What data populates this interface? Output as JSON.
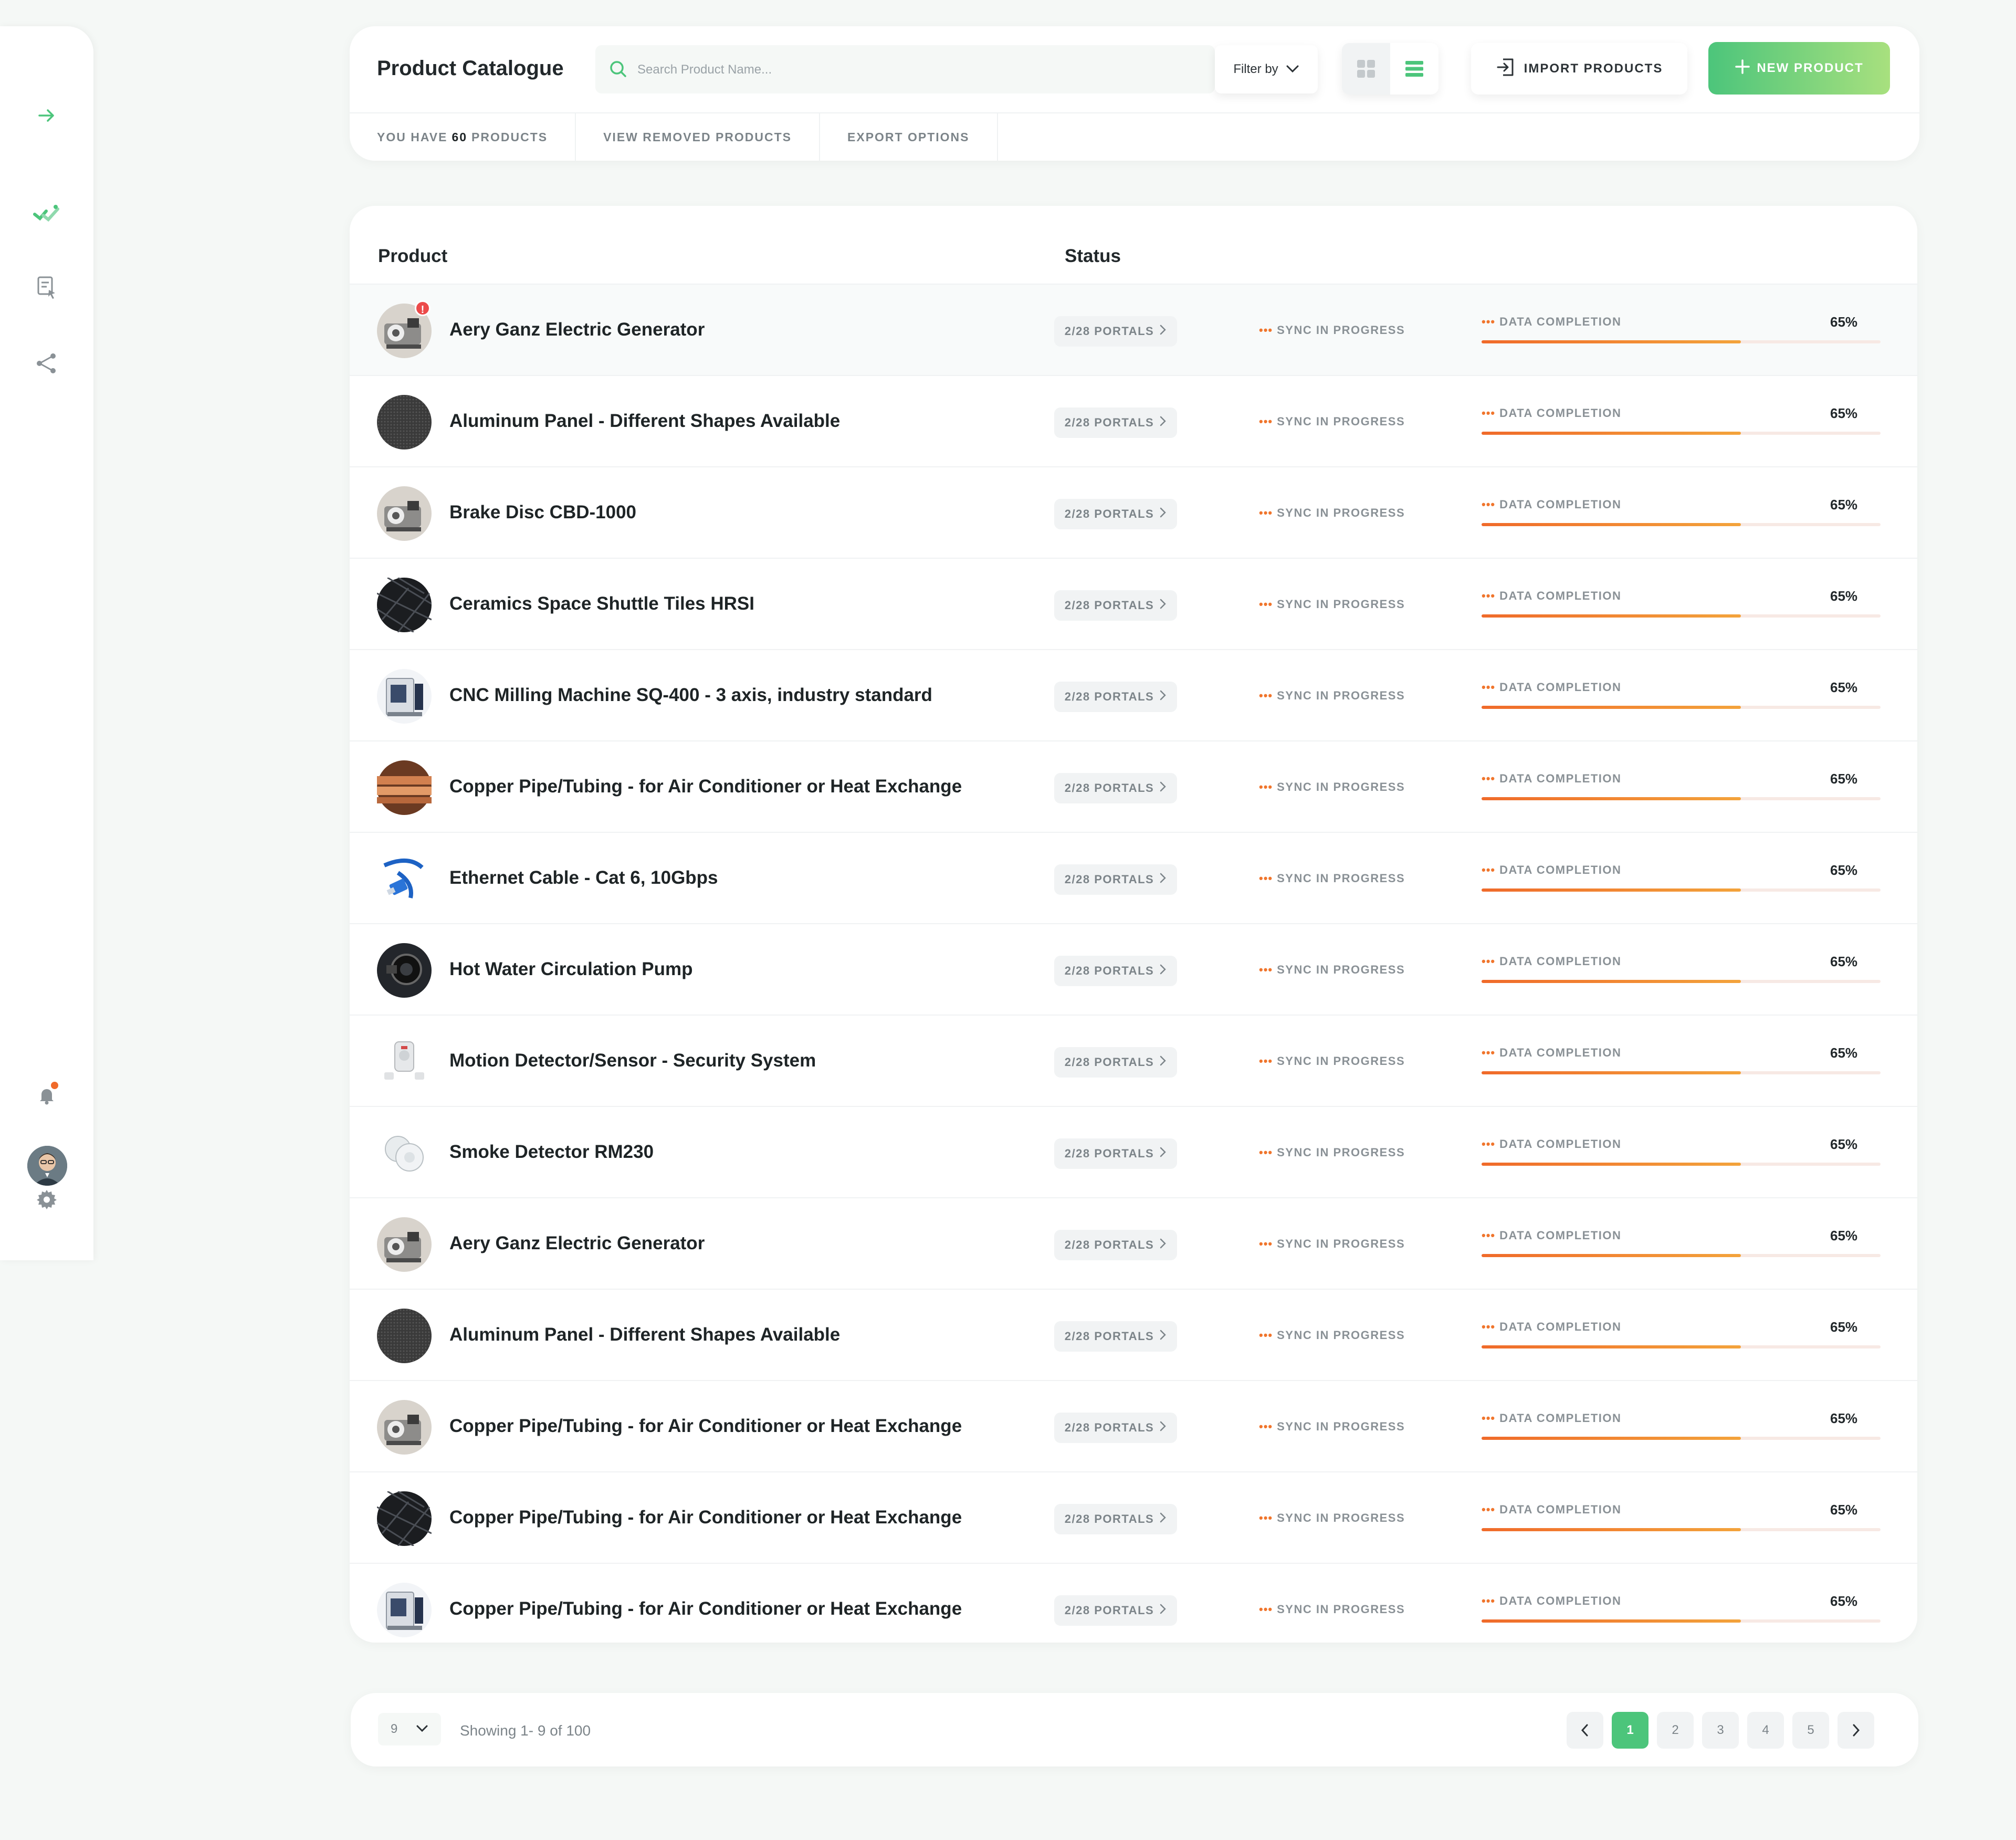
{
  "header": {
    "title": "Product Catalogue",
    "search_placeholder": "Search Product Name...",
    "filter_label": "Filter by",
    "import_label": "IMPORT PRODUCTS",
    "new_label": "NEW PRODUCT",
    "subnav": {
      "count_prefix": "YOU HAVE",
      "count": "60",
      "count_suffix": "PRODUCTS",
      "removed": "VIEW REMOVED PRODUCTS",
      "export": "EXPORT OPTIONS"
    }
  },
  "sidebar": {
    "icons": [
      "arrow-right-icon",
      "tag-icon",
      "document-pointer-icon",
      "share-icon",
      "bell-icon",
      "avatar",
      "gear-icon"
    ]
  },
  "table": {
    "headers": {
      "product": "Product",
      "status": "Status"
    },
    "rows": [
      {
        "name": "Aery Ganz Electric Generator",
        "portals": "2/28 PORTALS",
        "sync": "SYNC IN PROGRESS",
        "dc_label": "DATA COMPLETION",
        "dc_pct": "65%",
        "dc_value": 0.65,
        "thumb": "generator",
        "alert": "!"
      },
      {
        "name": "Aluminum Panel - Different Shapes Available",
        "portals": "2/28 PORTALS",
        "sync": "SYNC IN PROGRESS",
        "dc_label": "DATA COMPLETION",
        "dc_pct": "65%",
        "dc_value": 0.65,
        "thumb": "panel"
      },
      {
        "name": "Brake Disc CBD-1000",
        "portals": "2/28 PORTALS",
        "sync": "SYNC IN PROGRESS",
        "dc_label": "DATA COMPLETION",
        "dc_pct": "65%",
        "dc_value": 0.65,
        "thumb": "generator"
      },
      {
        "name": "Ceramics Space Shuttle Tiles HRSI",
        "portals": "2/28 PORTALS",
        "sync": "SYNC IN PROGRESS",
        "dc_label": "DATA COMPLETION",
        "dc_pct": "65%",
        "dc_value": 0.65,
        "thumb": "tiles"
      },
      {
        "name": "CNC Milling Machine SQ-400 - 3 axis, industry standard",
        "portals": "2/28 PORTALS",
        "sync": "SYNC IN PROGRESS",
        "dc_label": "DATA COMPLETION",
        "dc_pct": "65%",
        "dc_value": 0.65,
        "thumb": "cnc"
      },
      {
        "name": "Copper Pipe/Tubing - for Air Conditioner or Heat Exchange",
        "portals": "2/28 PORTALS",
        "sync": "SYNC IN PROGRESS",
        "dc_label": "DATA COMPLETION",
        "dc_pct": "65%",
        "dc_value": 0.65,
        "thumb": "copper"
      },
      {
        "name": "Ethernet Cable - Cat 6, 10Gbps",
        "portals": "2/28 PORTALS",
        "sync": "SYNC IN PROGRESS",
        "dc_label": "DATA COMPLETION",
        "dc_pct": "65%",
        "dc_value": 0.65,
        "thumb": "cable"
      },
      {
        "name": "Hot Water Circulation Pump",
        "portals": "2/28 PORTALS",
        "sync": "SYNC IN PROGRESS",
        "dc_label": "DATA COMPLETION",
        "dc_pct": "65%",
        "dc_value": 0.65,
        "thumb": "pump"
      },
      {
        "name": "Motion Detector/Sensor - Security System",
        "portals": "2/28 PORTALS",
        "sync": "SYNC IN PROGRESS",
        "dc_label": "DATA COMPLETION",
        "dc_pct": "65%",
        "dc_value": 0.65,
        "thumb": "motion"
      },
      {
        "name": "Smoke Detector RM230",
        "portals": "2/28 PORTALS",
        "sync": "SYNC IN PROGRESS",
        "dc_label": "DATA COMPLETION",
        "dc_pct": "65%",
        "dc_value": 0.65,
        "thumb": "smoke"
      },
      {
        "name": "Aery Ganz Electric Generator",
        "portals": "2/28 PORTALS",
        "sync": "SYNC IN PROGRESS",
        "dc_label": "DATA COMPLETION",
        "dc_pct": "65%",
        "dc_value": 0.65,
        "thumb": "generator"
      },
      {
        "name": "Aluminum Panel - Different Shapes Available",
        "portals": "2/28 PORTALS",
        "sync": "SYNC IN PROGRESS",
        "dc_label": "DATA COMPLETION",
        "dc_pct": "65%",
        "dc_value": 0.65,
        "thumb": "panel"
      },
      {
        "name": "Copper Pipe/Tubing - for Air Conditioner or Heat Exchange",
        "portals": "2/28 PORTALS",
        "sync": "SYNC IN PROGRESS",
        "dc_label": "DATA COMPLETION",
        "dc_pct": "65%",
        "dc_value": 0.65,
        "thumb": "generator"
      },
      {
        "name": "Copper Pipe/Tubing - for Air Conditioner or Heat Exchange",
        "portals": "2/28 PORTALS",
        "sync": "SYNC IN PROGRESS",
        "dc_label": "DATA COMPLETION",
        "dc_pct": "65%",
        "dc_value": 0.65,
        "thumb": "tiles"
      },
      {
        "name": "Copper Pipe/Tubing - for Air Conditioner or Heat Exchange",
        "portals": "2/28 PORTALS",
        "sync": "SYNC IN PROGRESS",
        "dc_label": "DATA COMPLETION",
        "dc_pct": "65%",
        "dc_value": 0.65,
        "thumb": "cnc"
      }
    ]
  },
  "pagination": {
    "per_page": "9",
    "showing": "Showing 1- 9 of 100",
    "pages": [
      "1",
      "2",
      "3",
      "4",
      "5"
    ],
    "active_page": "1"
  },
  "colors": {
    "accent_green": "#4cc57b",
    "progress_orange": "#f06a2a",
    "alert_red": "#ec4a4a"
  }
}
